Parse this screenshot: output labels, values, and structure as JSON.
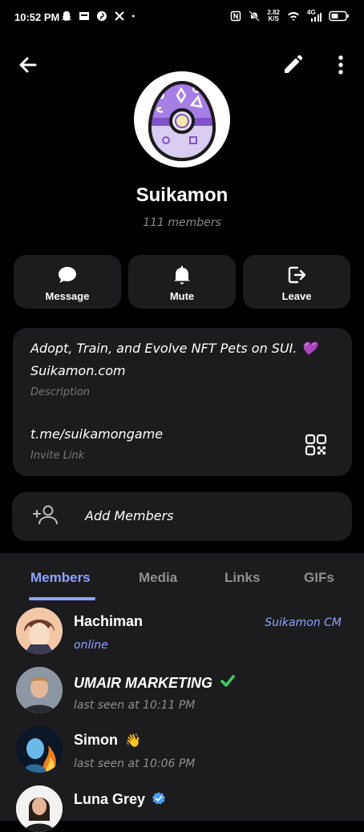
{
  "status_bar": {
    "time": "10:52 PM",
    "net_speed_value": "2.82",
    "net_speed_unit": "K/S",
    "signal_label": "4G",
    "icons_left": [
      "snapchat-icon",
      "app-icon",
      "pinterest-icon",
      "x-icon",
      "dot-icon"
    ],
    "icons_right": [
      "nfc-icon",
      "mute-bell-icon",
      "wifi-icon",
      "signal-icon",
      "battery-icon"
    ]
  },
  "group": {
    "title": "Suikamon",
    "members_count": "111 members"
  },
  "actions": [
    {
      "label": "Message",
      "icon": "chat-bubble-icon"
    },
    {
      "label": "Mute",
      "icon": "bell-icon"
    },
    {
      "label": "Leave",
      "icon": "leave-icon"
    }
  ],
  "info": {
    "description": "Adopt, Train, and Evolve NFT Pets on SUI. 💜",
    "description_line2": "Suikamon.com",
    "description_label": "Description",
    "invite_link": "t.me/suikamongame",
    "invite_label": "Invite Link"
  },
  "add_members": {
    "label": "Add Members"
  },
  "tabs": [
    {
      "label": "Members",
      "active": true
    },
    {
      "label": "Media",
      "active": false
    },
    {
      "label": "Links",
      "active": false
    },
    {
      "label": "GIFs",
      "active": false
    }
  ],
  "members": [
    {
      "name": "Hachiman",
      "status": "online",
      "role": "Suikamon CM"
    },
    {
      "name": "UMAIR MARKETING",
      "status": "last seen at 10:11 PM",
      "badge": "✅"
    },
    {
      "name": "Simon",
      "status": "last seen at 10:06 PM",
      "badge": "👋"
    },
    {
      "name": "Luna Grey",
      "status": "",
      "badge": "verified-icon"
    }
  ],
  "colors": {
    "accent": "#8ea3ff",
    "card": "#1c1c1e",
    "egg_purple": "#a77de6"
  }
}
